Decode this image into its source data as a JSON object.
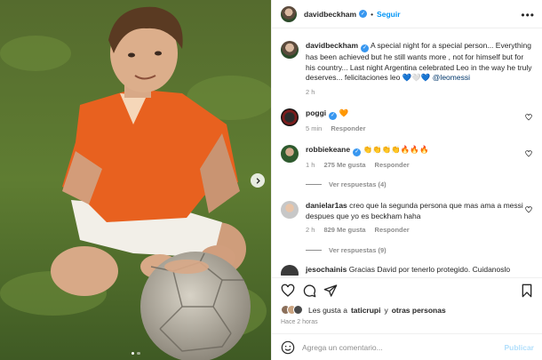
{
  "post": {
    "author": "davidbeckham",
    "follow_label": "Seguir",
    "more_label": "•••",
    "caption": "A special night for a special person... Everything has been achieved but he still wants more , not for himself but for his country... Last night Argentina celebrated Leo in the way he truly deserves... felicitaciones leo 💙🤍💙",
    "caption_mention": "@leomessi",
    "caption_time": "2 h"
  },
  "comments": [
    {
      "user": "poggi",
      "text": "🧡",
      "time": "5 min",
      "likes": "",
      "reply": "Responder"
    },
    {
      "user": "robbiekeane",
      "text": "👏👏👏👏🔥🔥🔥",
      "time": "1 h",
      "likes": "275 Me gusta",
      "reply": "Responder",
      "replies": "Ver respuestas (4)"
    },
    {
      "user": "danielar1as",
      "text": "creo que la segunda persona que mas ama a messi despues que yo es beckham haha",
      "time": "2 h",
      "likes": "829 Me gusta",
      "reply": "Responder",
      "replies": "Ver respuestas (9)"
    },
    {
      "user": "jesochainis",
      "text": "Gracias David por tenerlo protegido. Cuidanoslo"
    }
  ],
  "likes": {
    "prefix": "Les gusta a",
    "user": "taticrupi",
    "suffix": "y",
    "others": "otras personas"
  },
  "time_ago": "Hace 2 horas",
  "composer": {
    "placeholder": "Agrega un comentario...",
    "publish": "Publicar"
  },
  "icons": {
    "verified": "verified-check-icon",
    "heart": "heart-icon",
    "comment": "comment-icon",
    "share": "share-icon",
    "save": "bookmark-icon",
    "emoji": "emoji-icon",
    "next": "chevron-right-icon"
  },
  "colors": {
    "accent": "#0095f6",
    "verified": "#3897f0",
    "muted": "#8e8e8e"
  }
}
